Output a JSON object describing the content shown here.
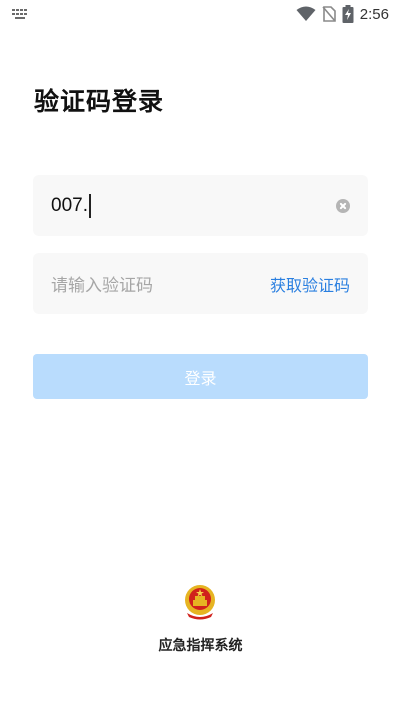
{
  "status_bar": {
    "time": "2:56",
    "icons": [
      "keyboard-icon",
      "wifi-icon",
      "no-sim-icon",
      "battery-charging-icon"
    ]
  },
  "page": {
    "title": "验证码登录"
  },
  "phone_field": {
    "value": "007."
  },
  "code_field": {
    "placeholder": "请输入验证码",
    "get_code_label": "获取验证码"
  },
  "login_button": {
    "label": "登录",
    "color": "#b9dcfd"
  },
  "footer": {
    "app_name": "应急指挥系统",
    "logo": "national-emblem-icon"
  },
  "colors": {
    "accent": "#2a7fe0",
    "field_bg": "#f8f8f8"
  }
}
